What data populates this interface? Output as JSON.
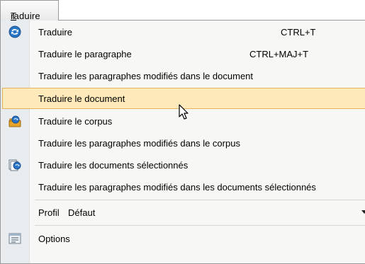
{
  "menubar": {
    "menu_title_underlined": "T",
    "menu_title_rest": "raduire"
  },
  "menu": {
    "items": [
      {
        "label": "Traduire",
        "shortcut": "CTRL+T",
        "icon": "translate-icon"
      },
      {
        "label": "Traduire le paragraphe",
        "shortcut": "CTRL+MAJ+T"
      },
      {
        "label": "Traduire les paragraphes modifiés dans le document"
      },
      {
        "label": "Traduire le document",
        "highlighted": true
      },
      {
        "label": "Traduire le corpus",
        "icon": "corpus-icon"
      },
      {
        "label": "Traduire les paragraphes modifiés dans le corpus"
      },
      {
        "label": "Traduire les documents sélectionnés",
        "icon": "documents-icon"
      },
      {
        "label": "Traduire les paragraphes modifiés dans les documents sélectionnés"
      }
    ],
    "profil": {
      "label": "Profil",
      "value": "Défaut"
    },
    "options": {
      "label": "Options",
      "icon": "options-icon"
    }
  },
  "colors": {
    "highlight_fill": "#fde9b9",
    "highlight_border": "#e3b35a",
    "icon_strip": "#e9ecef",
    "menu_background": "#f7f7f5"
  }
}
